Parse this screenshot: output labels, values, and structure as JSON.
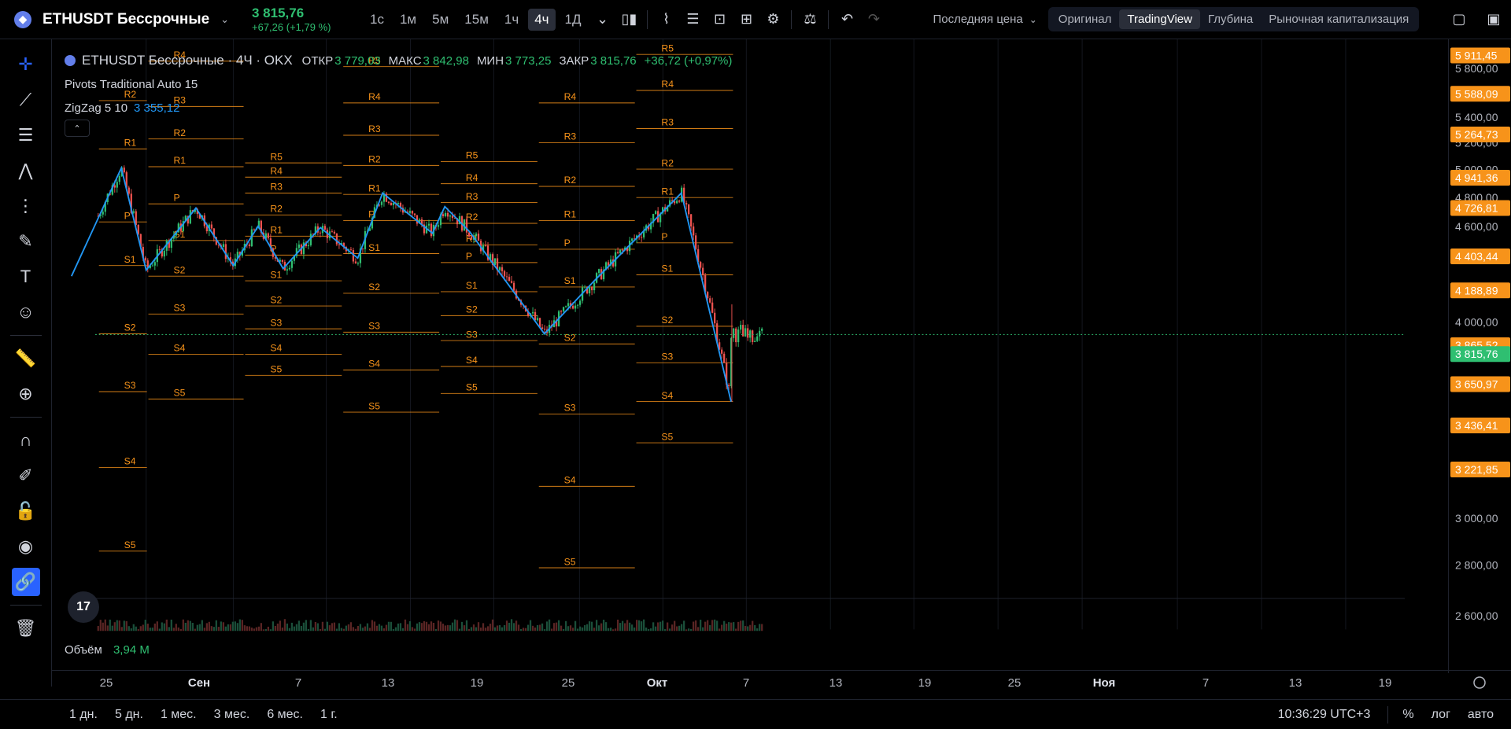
{
  "header": {
    "symbol": "ETHUSDT Бессрочные",
    "price": "3 815,76",
    "change": "+67,26 (+1,79 %)",
    "timeframes": [
      "1с",
      "1м",
      "5м",
      "15м",
      "1ч",
      "4ч",
      "1Д"
    ],
    "active_timeframe": "4ч",
    "price_mode": "Последняя цена",
    "view_tabs": [
      "Оригинал",
      "TradingView",
      "Глубина",
      "Рыночная капитализация"
    ],
    "active_view": "TradingView"
  },
  "legend": {
    "title": "ETHUSDT Бессрочные · 4Ч · OKX",
    "open_label": "ОТКР",
    "open": "3 779,03",
    "high_label": "МАКС",
    "high": "3 842,98",
    "low_label": "МИН",
    "low": "3 773,25",
    "close_label": "ЗАКР",
    "close": "3 815,76",
    "change": "+36,72 (+0,97%)",
    "pivots": "Pivots Traditional Auto 15",
    "zigzag": "ZigZag 5 10",
    "zigzag_value": "3 355,12"
  },
  "volume": {
    "label": "Объём",
    "value": "3,94 M"
  },
  "colors": {
    "up": "#2fbf71",
    "down": "#ef5350",
    "pivot": "#f7931a",
    "zigzag": "#2196f3"
  },
  "y_axis": {
    "ticks": [
      "5 800,00",
      "5 400,00",
      "5 200,00",
      "5 000,00",
      "4 800,00",
      "4 600,00",
      "4 000,00",
      "3 000,00",
      "2 800,00",
      "2 600,00"
    ],
    "badges": [
      "5 911,45",
      "5 588,09",
      "5 264,73",
      "4 941,36",
      "4 726,81",
      "4 403,44",
      "4 188,89",
      "3 865,52",
      "3 650,97",
      "3 436,41",
      "3 221,85"
    ],
    "current_price": "3 815,76"
  },
  "x_axis": {
    "labels": [
      "25",
      "Сен",
      "7",
      "13",
      "19",
      "25",
      "Окт",
      "7",
      "13",
      "19",
      "25",
      "Ноя",
      "7",
      "13",
      "19"
    ]
  },
  "bottom": {
    "ranges": [
      "1 дн.",
      "5 дн.",
      "1 мес.",
      "3 мес.",
      "6 мес.",
      "1 г."
    ],
    "time": "10:36:29 UTC+3",
    "percent": "%",
    "log": "лог",
    "auto": "авто"
  },
  "pivot_labels": [
    "R5",
    "R4",
    "R3",
    "R2",
    "R1",
    "P",
    "S1",
    "S2",
    "S3",
    "S4",
    "S5"
  ],
  "chart_data": {
    "type": "candlestick",
    "title": "ETHUSDT Бессрочные · 4Ч · OKX",
    "y_scale": "log",
    "ylim": [
      2500,
      6000
    ],
    "zigzag": [
      [
        "08-19",
        4180
      ],
      [
        "08-23",
        4950
      ],
      [
        "08-25",
        4220
      ],
      [
        "08-29",
        4650
      ],
      [
        "09-01",
        4250
      ],
      [
        "09-03",
        4520
      ],
      [
        "09-05",
        4230
      ],
      [
        "09-08",
        4510
      ],
      [
        "09-11",
        4300
      ],
      [
        "09-13",
        4760
      ],
      [
        "09-17",
        4470
      ],
      [
        "09-18",
        4660
      ],
      [
        "09-20",
        4480
      ],
      [
        "09-26",
        3820
      ],
      [
        "09-30",
        4150
      ],
      [
        "10-07",
        4760
      ],
      [
        "10-11",
        3436
      ]
    ]
  }
}
